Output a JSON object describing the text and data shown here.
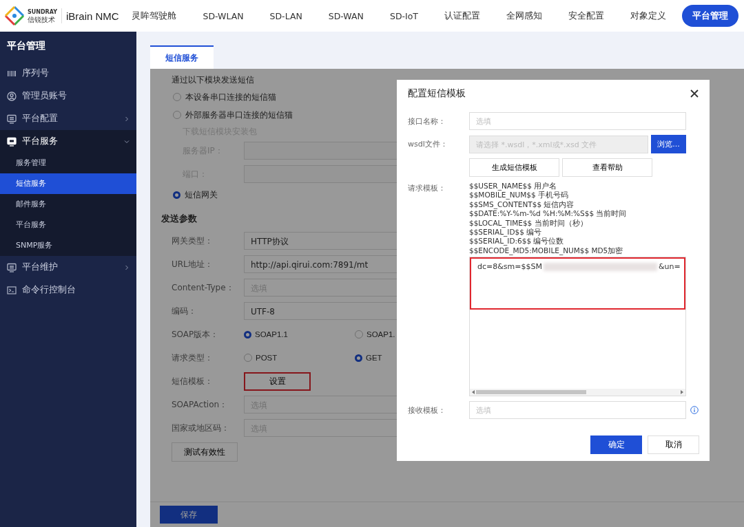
{
  "header": {
    "brand_top": "SUNDRAY",
    "brand_bottom": "信锐技术",
    "product": "iBrain NMC",
    "nav": [
      {
        "label": "灵眸驾驶舱",
        "selected": false
      },
      {
        "label": "SD-WLAN",
        "selected": false
      },
      {
        "label": "SD-LAN",
        "selected": false
      },
      {
        "label": "SD-WAN",
        "selected": false
      },
      {
        "label": "SD-IoT",
        "selected": false
      },
      {
        "label": "认证配置",
        "selected": false
      },
      {
        "label": "全网感知",
        "selected": false
      },
      {
        "label": "安全配置",
        "selected": false
      },
      {
        "label": "对象定义",
        "selected": false
      },
      {
        "label": "平台管理",
        "selected": true
      }
    ]
  },
  "sidebar": {
    "title": "平台管理",
    "items": [
      {
        "label": "序列号"
      },
      {
        "label": "管理员账号"
      },
      {
        "label": "平台配置",
        "expanded": false
      },
      {
        "label": "平台服务",
        "expanded": true,
        "children": [
          {
            "label": "服务管理",
            "selected": false
          },
          {
            "label": "短信服务",
            "selected": true
          },
          {
            "label": "邮件服务",
            "selected": false
          },
          {
            "label": "平台服务",
            "selected": false
          },
          {
            "label": "SNMP服务",
            "selected": false
          }
        ]
      },
      {
        "label": "平台维护",
        "expanded": false
      },
      {
        "label": "命令行控制台"
      }
    ]
  },
  "tabs": [
    {
      "label": "短信服务",
      "selected": true
    }
  ],
  "send_via": {
    "label": "通过以下模块发送短信",
    "options": [
      {
        "label": "本设备串口连接的短信猫",
        "selected": false
      },
      {
        "label": "外部服务器串口连接的短信猫",
        "selected": false,
        "download_link": "下载短信模块安装包",
        "fields": [
          {
            "label": "服务器IP："
          },
          {
            "label": "端口："
          }
        ]
      },
      {
        "label": "短信网关",
        "selected": true
      }
    ]
  },
  "params": {
    "title": "发送参数",
    "rows": [
      {
        "kind": "field",
        "label": "网关类型：",
        "value": "HTTP协议"
      },
      {
        "kind": "field",
        "label": "URL地址：",
        "value": "http://api.qirui.com:7891/mt"
      },
      {
        "kind": "field",
        "label": "Content-Type：",
        "placeholder": "选填"
      },
      {
        "kind": "field",
        "label": "编码：",
        "value": "UTF-8"
      },
      {
        "kind": "radio",
        "label": "SOAP版本：",
        "options": [
          {
            "label": "SOAP1.1",
            "selected": true
          },
          {
            "label": "SOAP1.",
            "selected": false
          }
        ]
      },
      {
        "kind": "radio",
        "label": "请求类型：",
        "options": [
          {
            "label": "POST",
            "selected": false
          },
          {
            "label": "GET",
            "selected": true
          }
        ]
      },
      {
        "kind": "button",
        "label": "短信模板：",
        "button": "设置",
        "highlighted": true
      },
      {
        "kind": "field",
        "label": "SOAPAction：",
        "placeholder": "选填"
      },
      {
        "kind": "field",
        "label": "国家或地区码：",
        "placeholder": "选填"
      }
    ],
    "test_button": "测试有效性"
  },
  "footer": {
    "save_button": "保存"
  },
  "dialog": {
    "title": "配置短信模板",
    "interface_name": {
      "label": "接口名称：",
      "placeholder": "选填"
    },
    "wsdl": {
      "label": "wsdl文件：",
      "placeholder": "请选择 *.wsdl，*.xml或*.xsd 文件",
      "browse": "浏览..."
    },
    "actions": [
      "生成短信模板",
      "查看帮助"
    ],
    "request_template": {
      "label": "请求模板：",
      "help_lines": [
        "$$USER_NAME$$ 用户名",
        "$$MOBILE_NUM$$ 手机号码",
        "$$SMS_CONTENT$$ 短信内容",
        "$$DATE:%Y-%m-%d %H:%M:%S$$ 当前时间",
        "$$LOCAL_TIME$$ 当前时间（秒）",
        "$$SERIAL_ID$$ 编号",
        "$$SERIAL_ID:6$$ 编号位数",
        "$$ENCODE_MD5:MOBILE_NUM$$ MD5加密"
      ],
      "value_start": "dc=8&sm=$$SM",
      "value_end": "&un=",
      "redacted": true,
      "highlighted": true
    },
    "receive_template": {
      "label": "接收模板：",
      "placeholder": "选填"
    },
    "buttons": [
      {
        "label": "确定",
        "kind": "primary"
      },
      {
        "label": "取消",
        "kind": "default"
      }
    ]
  }
}
